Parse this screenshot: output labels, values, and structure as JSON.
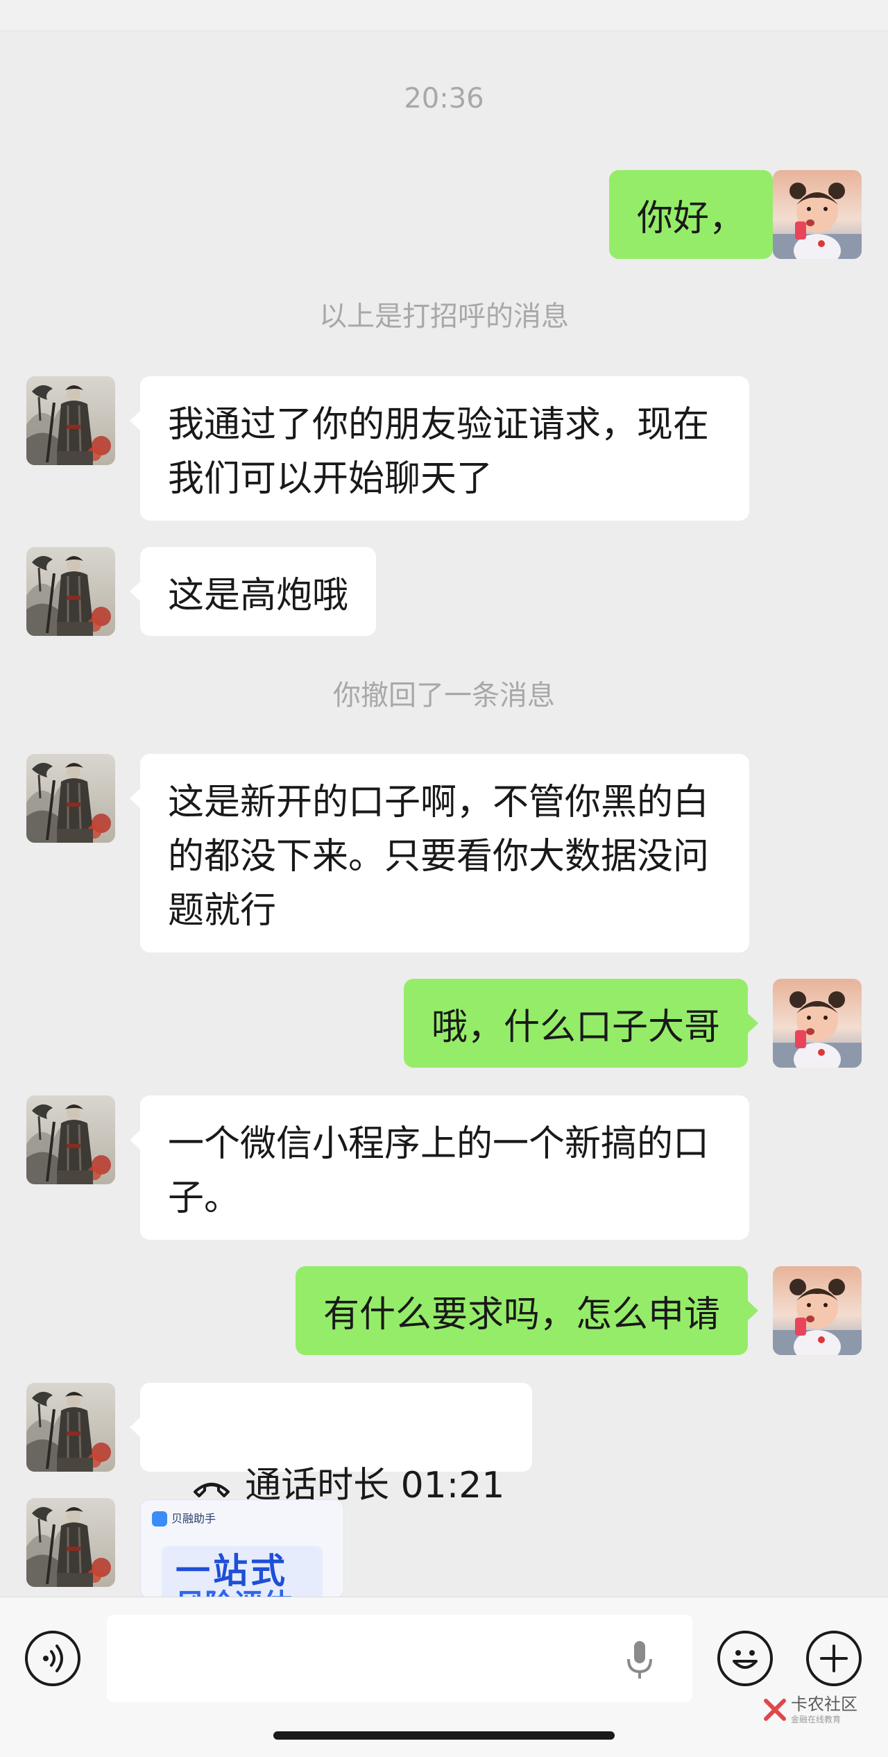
{
  "chat": {
    "timestamp": "20:36",
    "messages": [
      {
        "side": "out",
        "text": "你好，"
      },
      {
        "side": "system",
        "text": "以上是打招呼的消息"
      },
      {
        "side": "in",
        "text": "我通过了你的朋友验证请求，现在\n我们可以开始聊天了"
      },
      {
        "side": "in",
        "text": "这是高炮哦"
      },
      {
        "side": "system",
        "text": "你撤回了一条消息"
      },
      {
        "side": "in",
        "text": "这是新开的口子啊，不管你黑的白\n的都没下来。只要看你大数据没问\n题就行"
      },
      {
        "side": "out",
        "text": "哦，什么口子大哥"
      },
      {
        "side": "in",
        "text": "一个微信小程序上的一个新搞的口\n子。"
      },
      {
        "side": "out",
        "text": "有什么要求吗，怎么申请"
      },
      {
        "side": "in",
        "type": "call",
        "text": "通话时长 01:21",
        "icon": "phone-hangup-icon"
      },
      {
        "side": "in",
        "type": "card",
        "brand": "贝融助手",
        "title": "一站式",
        "subtitle": "风险评估"
      }
    ]
  },
  "input_bar": {
    "placeholder": "",
    "icons": [
      "voice-icon",
      "microphone-icon",
      "emoji-icon",
      "add-icon"
    ]
  },
  "watermark": {
    "title": "卡农社区",
    "subtitle": "金融在线教育"
  },
  "colors": {
    "background": "#ededed",
    "outgoing_bubble": "#95ec69",
    "incoming_bubble": "#ffffff",
    "system_text": "#a8a8a8"
  }
}
